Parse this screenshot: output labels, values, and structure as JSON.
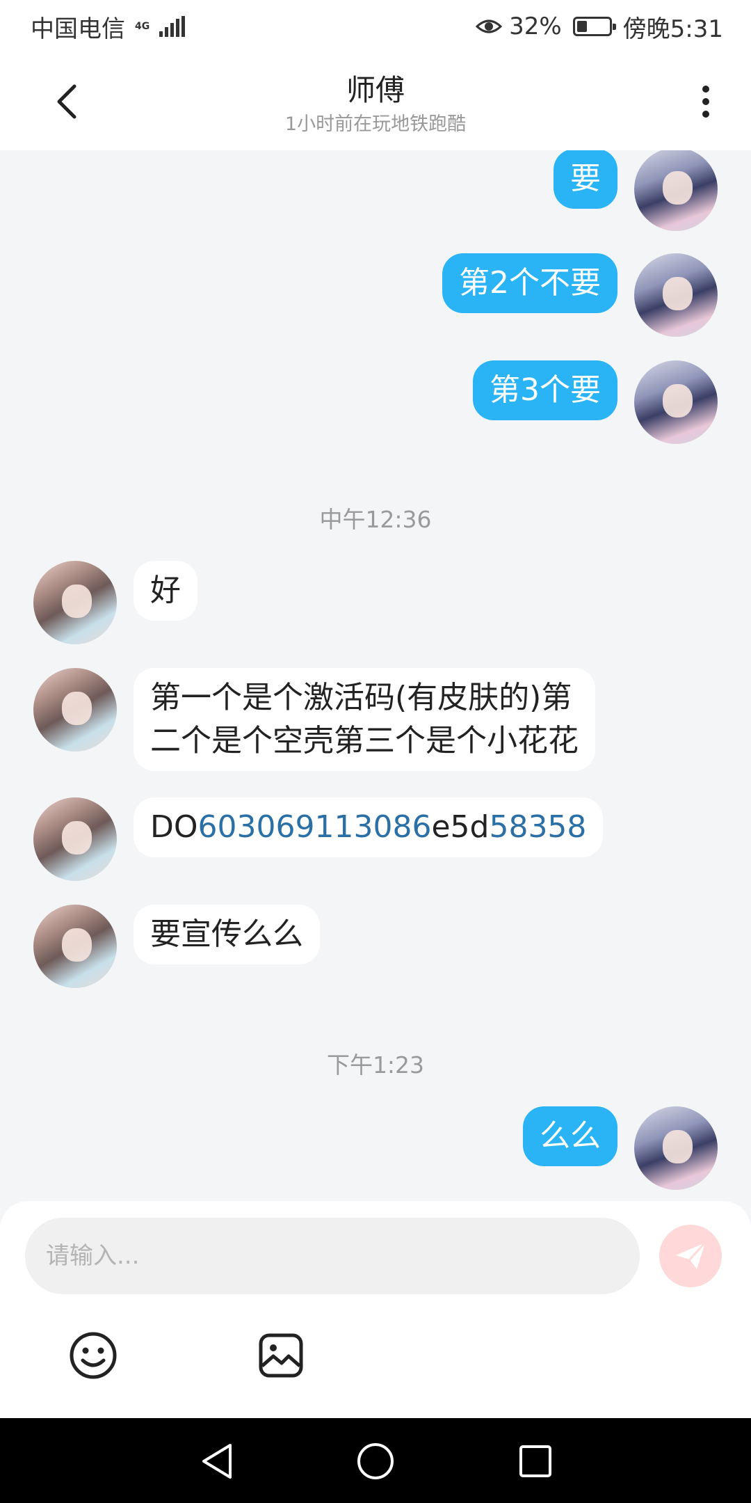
{
  "status_bar": {
    "carrier": "中国电信",
    "network": "4G",
    "battery_percent": "32%",
    "battery_level": 0.32,
    "time": "傍晚5:31"
  },
  "header": {
    "title": "师傅",
    "subtitle": "1小时前在玩地铁跑酷",
    "back_icon": "chevron-left-icon",
    "more_icon": "more-vertical-icon"
  },
  "messages": [
    {
      "side": "me",
      "text": "要"
    },
    {
      "side": "me",
      "text": "第2个不要"
    },
    {
      "side": "me",
      "text": "第3个要"
    },
    {
      "time": "中午12:36"
    },
    {
      "side": "other",
      "text": "好"
    },
    {
      "side": "other",
      "lines": [
        "第一个是个激活码(有皮肤的)第",
        "二个是个空壳第三个是个小花花"
      ]
    },
    {
      "side": "other",
      "parts": [
        {
          "text": "DO",
          "link": false
        },
        {
          "text": "603069113086",
          "link": true
        },
        {
          "text": "e5d",
          "link": false
        },
        {
          "text": "58358",
          "link": true
        }
      ]
    },
    {
      "side": "other",
      "text": "要宣传么么"
    },
    {
      "time": "下午1:23"
    },
    {
      "side": "me",
      "text": "么么"
    }
  ],
  "composer": {
    "placeholder": "请输入...",
    "send_icon": "paper-plane-icon",
    "emoji_icon": "smiley-icon",
    "image_icon": "image-icon"
  },
  "colors": {
    "my_bubble": "#2bb4f5",
    "other_bubble": "#ffffff",
    "link": "#2a6fa6",
    "send_button": "#ffd9d9",
    "background": "#f4f5f7"
  }
}
